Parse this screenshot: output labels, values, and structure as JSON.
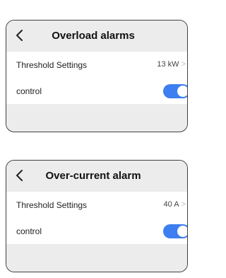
{
  "panels": [
    {
      "title": "Overload alarms",
      "threshold": {
        "label": "Threshold Settings",
        "value": "13 kW"
      },
      "control": {
        "label": "control",
        "enabled": true
      }
    },
    {
      "title": "Over-current alarm",
      "threshold": {
        "label": "Threshold Settings",
        "value": "40 A"
      },
      "control": {
        "label": "control",
        "enabled": true
      }
    }
  ],
  "icons": {
    "back": "back-icon",
    "chevron": "chevron-right-icon"
  },
  "colors": {
    "toggle_on": "#3d7ef0",
    "header_bg": "#ececec"
  }
}
